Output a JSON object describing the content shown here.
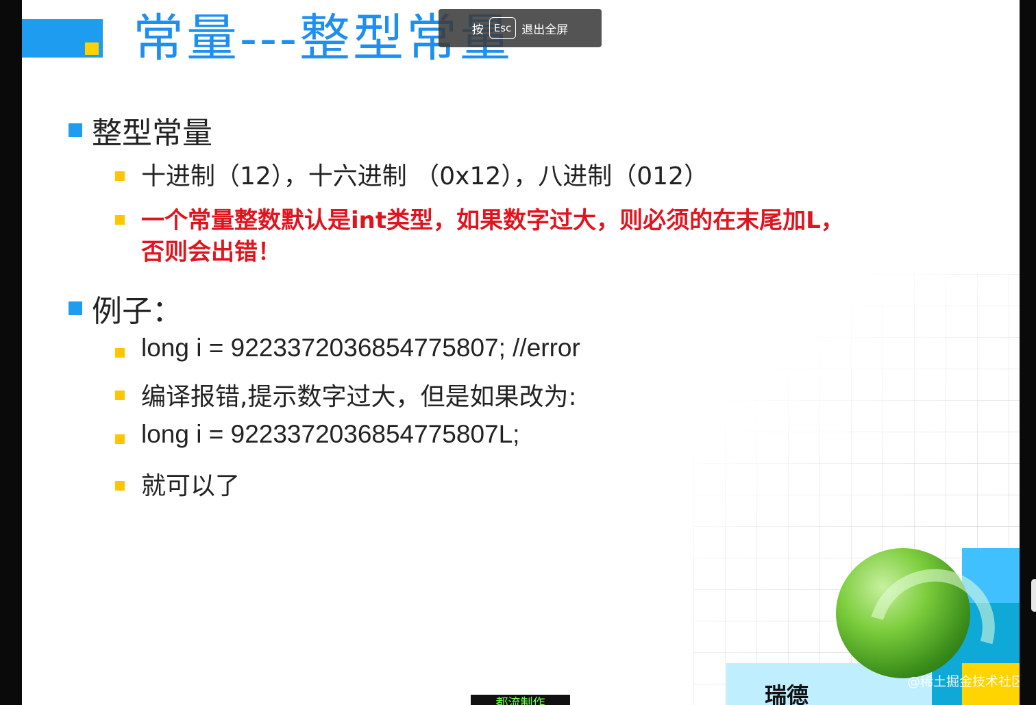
{
  "slide": {
    "title": "常量---整型常量",
    "section1": {
      "heading": "整型常量",
      "items": [
        "十进制（12），十六进制 （0x12），八进制（012）",
        "一个常量整数默认是int类型，如果数字过大，则必须的在末尾加L，",
        "否则会出错！"
      ]
    },
    "section2": {
      "heading": "例子：",
      "items": [
        "long i = 9223372036854775807;   //error",
        "编译报错,提示数字过大，但是如果改为:",
        "long i = 9223372036854775807L;",
        "就可以了"
      ]
    },
    "logo_text": "瑞德",
    "bottom_label": "都流制作"
  },
  "overlay": {
    "press": "按",
    "key": "Esc",
    "exit": "退出全屏"
  },
  "watermark": "@稀土掘金技术社区",
  "colors": {
    "accent_blue": "#1e9cf0",
    "bullet_yellow": "#ffc600",
    "emphasis_red": "#e0141e"
  }
}
